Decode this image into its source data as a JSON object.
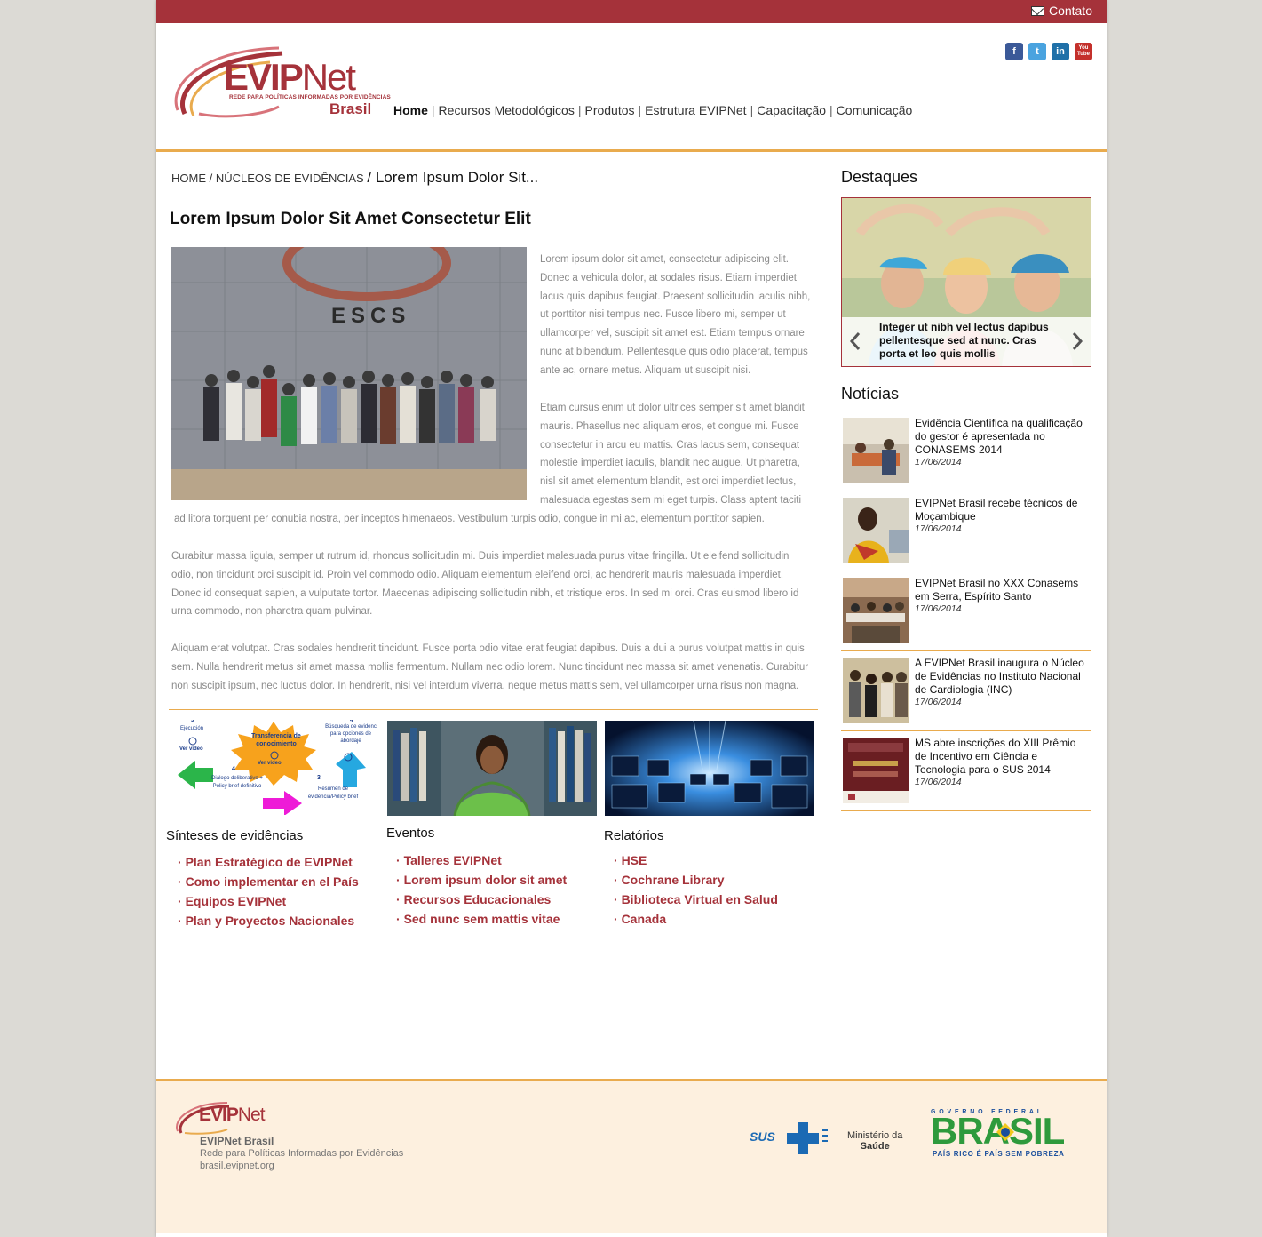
{
  "topbar": {
    "contact_label": "Contato"
  },
  "header": {
    "logo_name": "EVIPNet",
    "logo_name_evip": "EVIP",
    "logo_name_net": "Net",
    "logo_tagline": "REDE PARA POLÍTICAS INFORMADAS POR EVIDÊNCIAS",
    "logo_country": "Brasil",
    "social": [
      {
        "icon": "facebook-icon",
        "glyph": "f",
        "color": "#3b5998"
      },
      {
        "icon": "twitter-icon",
        "glyph": "t",
        "color": "#4aa3df"
      },
      {
        "icon": "linkedin-icon",
        "glyph": "in",
        "color": "#1f70a8"
      },
      {
        "icon": "youtube-icon",
        "glyph": "You Tube",
        "color": "#c4302b"
      }
    ]
  },
  "nav": {
    "items": [
      "Home",
      "Recursos Metodológicos",
      "Produtos",
      "Estrutura EVIPNet",
      "Capacitação",
      "Comunicação"
    ],
    "active_index": 0
  },
  "breadcrumb": {
    "home": "HOME",
    "section": "NÚCLEOS DE EVIDÊNCIAS",
    "current": "Lorem Ipsum Dolor Sit..."
  },
  "article": {
    "title": "Lorem Ipsum Dolor Sit Amet Consectetur Elit",
    "photo_sign": "ESCS",
    "p1": "Lorem ipsum dolor sit amet, consectetur adipiscing elit. Donec a vehicula dolor, at sodales risus. Etiam imperdiet lacus quis dapibus feugiat. Praesent sollicitudin iaculis nibh, ut porttitor nisi tempus nec. Fusce libero mi, semper ut ullamcorper vel, suscipit sit amet est. Etiam tempus ornare nunc at bibendum. Pellentesque quis odio placerat, tempus ante ac, ornare metus. Aliquam ut suscipit nisi.",
    "p2a": "Etiam cursus enim ut dolor ultrices semper sit amet blandit mauris. Phasellus nec aliquam eros, et congue mi. Fusce consectetur in arcu eu mattis. Cras lacus sem, consequat molestie imperdiet iaculis, blandit nec augue. Ut pharetra, nisl sit amet elementum blandit, est orci imperdiet lectus, malesuada egestas sem mi eget turpis. Class aptent taciti",
    "p2b": "ad litora torquent per conubia nostra, per inceptos himenaeos. Vestibulum turpis odio, congue in mi ac, elementum porttitor sapien.",
    "p3": "Curabitur massa ligula, semper ut rutrum id, rhoncus sollicitudin mi. Duis imperdiet malesuada purus vitae fringilla. Ut eleifend sollicitudin odio, non tincidunt orci suscipit id. Proin vel commodo odio. Aliquam elementum eleifend orci, ac hendrerit mauris malesuada imperdiet. Donec id consequat sapien, a vulputate tortor. Maecenas adipiscing sollicitudin nibh, et tristique eros. In sed mi orci. Cras euismod libero id urna commodo, non pharetra quam pulvinar.",
    "p4": "Aliquam erat volutpat. Cras sodales hendrerit tincidunt. Fusce porta odio vitae erat feugiat dapibus. Duis a dui a purus volutpat mattis in quis sem. Nulla hendrerit metus sit amet massa mollis fermentum. Nullam nec odio lorem. Nunc tincidunt nec massa sit amet venenatis. Curabitur non suscipit ipsum, nec luctus dolor. In hendrerit, nisi vel interdum viverra, neque metus mattis sem, vel ullamcorper urna risus non magna."
  },
  "diagram": {
    "center": "Transferencia de conocimiento",
    "ver_video": "Ver video",
    "n3_top": "3",
    "n4_top": "4",
    "n3_bottom": "3",
    "n4": "4",
    "ejecucion": "Ejecución",
    "busqueda": "Búsqueda de evidenc para opciones de abordaje",
    "dialogo": "Diálogo deliberativo + Policy brief definitivo",
    "resumen": "Resumen de evidencia/Policy brief"
  },
  "columns": [
    {
      "title": "Sínteses de evidências",
      "links": [
        "Plan Estratégico de EVIPNet",
        "Como implementar en el País",
        "Equipos EVIPNet",
        "Plan y Proyectos Nacionales"
      ]
    },
    {
      "title": "Eventos",
      "links": [
        "Talleres EVIPNet",
        "Lorem ipsum dolor sit amet",
        "Recursos Educacionales",
        "Sed nunc sem mattis vitae"
      ]
    },
    {
      "title": "Relatórios",
      "links": [
        "HSE",
        "Cochrane Library",
        "Biblioteca Virtual en Salud",
        "Canada"
      ]
    }
  ],
  "sidebar": {
    "destaques_title": "Destaques",
    "slider_caption": "Integer ut nibh vel lectus dapibus pellentesque sed at nunc. Cras porta et leo quis mollis",
    "noticias_title": "Notícias",
    "news": [
      {
        "title": "Evidência Científica na qualificação do gestor é apresentada no CONASEMS 2014",
        "date": "17/06/2014"
      },
      {
        "title": "EVIPNet Brasil recebe técnicos de Moçambique",
        "date": "17/06/2014"
      },
      {
        "title": "EVIPNet Brasil no XXX Conasems em Serra, Espírito Santo",
        "date": "17/06/2014"
      },
      {
        "title": "A EVIPNet Brasil inaugura o Núcleo de Evidências no Instituto Nacional de Cardiologia (INC)",
        "date": "17/06/2014"
      },
      {
        "title": "MS abre inscrições do XIII Prêmio de Incentivo em Ciência e Tecnologia para o SUS 2014",
        "date": "17/06/2014"
      }
    ]
  },
  "footer": {
    "logo_name": "EVIPNet",
    "logo_name_evip": "EVIP",
    "logo_name_net": "Net",
    "name": "EVIPNet Brasil",
    "tagline": "Rede para Políticas Informadas por Evidências",
    "url": "brasil.evipnet.org",
    "sus": "SUS",
    "ministerio_line1": "Ministério da",
    "ministerio_line2": "Saúde",
    "gov_top": "GOVERNO FEDERAL",
    "gov_brasil": "BRASIL",
    "gov_bottom": "PAÍS RICO É PAÍS SEM POBREZA"
  },
  "colors": {
    "brand": "#a5323a",
    "accent": "#e9ab4e",
    "footer_bg": "#fdf0df",
    "page_bg": "#dcdad5"
  }
}
